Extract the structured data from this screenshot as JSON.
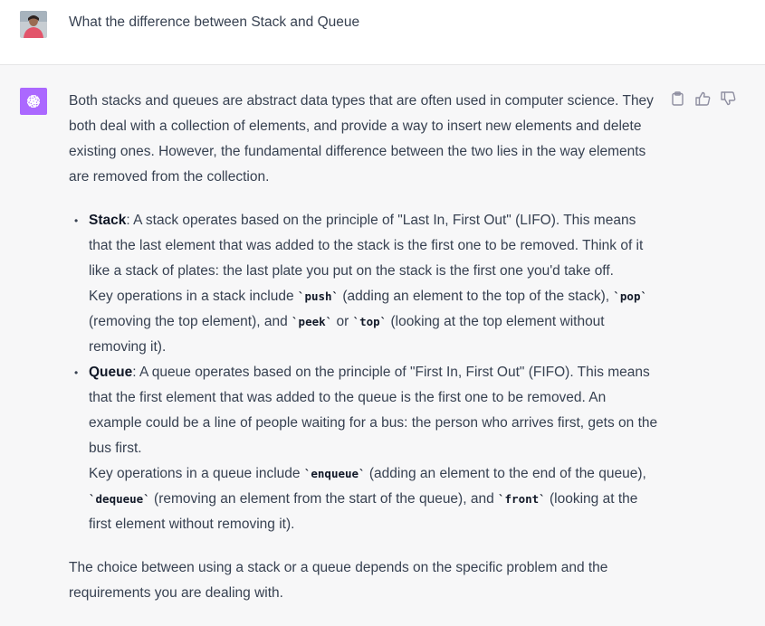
{
  "user_message": {
    "text": "What the difference between Stack and Queue"
  },
  "assistant_message": {
    "intro": "Both stacks and queues are abstract data types that are often used in computer science. They both deal with a collection of elements, and provide a way to insert new elements and delete existing ones. However, the fundamental difference between the two lies in the way elements are removed from the collection.",
    "stack": {
      "term": "Stack",
      "desc": ": A stack operates based on the principle of \"Last In, First Out\" (LIFO). This means that the last element that was added to the stack is the first one to be removed. Think of it like a stack of plates: the last plate you put on the stack is the first one you'd take off.",
      "ops_prefix": "Key operations in a stack include ",
      "op_push": "`push`",
      "ops_push_desc": " (adding an element to the top of the stack), ",
      "op_pop": "`pop`",
      "ops_pop_desc": " (removing the top element), and ",
      "op_peek": "`peek`",
      "ops_or": " or ",
      "op_top": "`top`",
      "ops_top_desc": " (looking at the top element without removing it)."
    },
    "queue": {
      "term": "Queue",
      "desc": ": A queue operates based on the principle of \"First In, First Out\" (FIFO). This means that the first element that was added to the queue is the first one to be removed. An example could be a line of people waiting for a bus: the person who arrives first, gets on the bus first.",
      "ops_prefix": "Key operations in a queue include ",
      "op_enqueue": "`enqueue`",
      "ops_enqueue_desc": " (adding an element to the end of the queue), ",
      "op_dequeue": "`dequeue`",
      "ops_dequeue_desc": " (removing an element from the start of the queue), and ",
      "op_front": "`front`",
      "ops_front_desc": " (looking at the first element without removing it)."
    },
    "conclusion": "The choice between using a stack or a queue depends on the specific problem and the requirements you are dealing with."
  },
  "actions": {
    "copy_icon": "clipboard-icon",
    "like_icon": "thumbs-up-icon",
    "dislike_icon": "thumbs-down-icon"
  },
  "colors": {
    "assistant_bg": "#f7f7f8",
    "bot_avatar_bg": "#ab68ff",
    "text": "#374151"
  }
}
